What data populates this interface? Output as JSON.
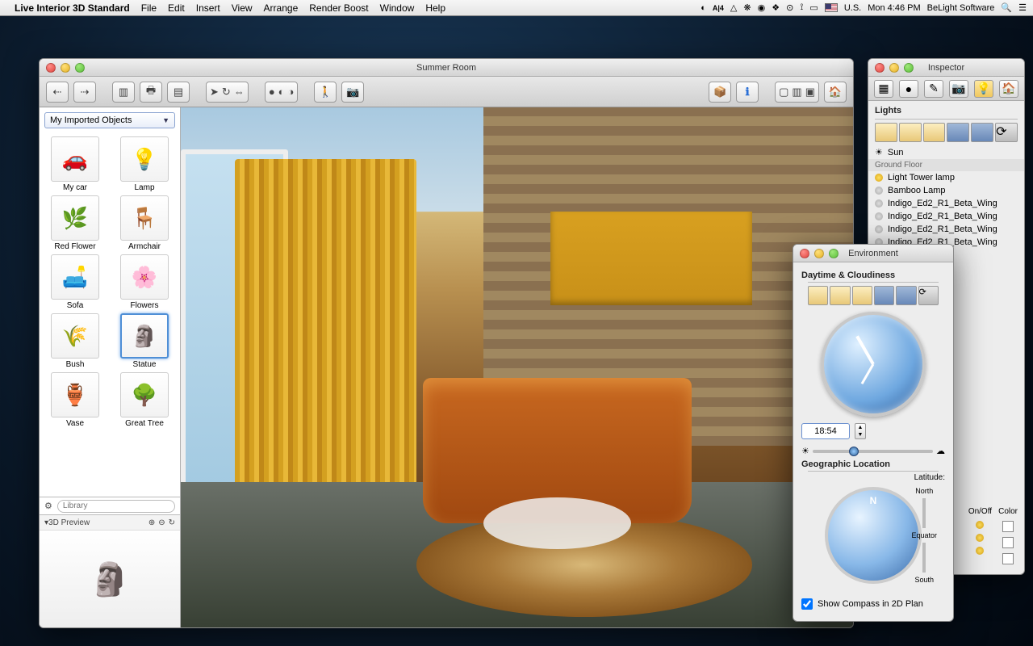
{
  "menubar": {
    "apple": "",
    "app_name": "Live Interior 3D Standard",
    "items": [
      "File",
      "Edit",
      "Insert",
      "View",
      "Arrange",
      "Render Boost",
      "Window",
      "Help"
    ],
    "status_icons": [
      "sync-icon",
      "adobe-icon",
      "drive-icon",
      "cloud-icon",
      "dropbox-icon",
      "bt-icon",
      "vol-icon",
      "wifi-icon",
      "battery-icon"
    ],
    "locale": "U.S.",
    "clock": "Mon 4:46 PM",
    "user": "BeLight Software"
  },
  "main": {
    "title": "Summer Room",
    "toolbar": {
      "nav": [
        "back",
        "fwd"
      ],
      "left": [
        "library-toggle",
        "print",
        "layers"
      ],
      "select": [
        "pointer",
        "orbit",
        "pan"
      ],
      "record": [
        "record",
        "play",
        "stop"
      ],
      "walk": "walk",
      "camera": "camera",
      "right": [
        "export-3d",
        "info",
        "2d-view",
        "split-view",
        "3d-view",
        "home"
      ]
    },
    "library": {
      "dropdown": "My Imported Objects",
      "items": [
        {
          "label": "My car",
          "glyph": "🚗"
        },
        {
          "label": "Lamp",
          "glyph": "💡"
        },
        {
          "label": "Red Flower",
          "glyph": "🌿"
        },
        {
          "label": "Armchair",
          "glyph": "🪑"
        },
        {
          "label": "Sofa",
          "glyph": "🛋️"
        },
        {
          "label": "Flowers",
          "glyph": "🌸"
        },
        {
          "label": "Bush",
          "glyph": "🌾"
        },
        {
          "label": "Statue",
          "glyph": "🗿",
          "selected": true
        },
        {
          "label": "Vase",
          "glyph": "🏺"
        },
        {
          "label": "Great Tree",
          "glyph": "🌳"
        }
      ],
      "search_placeholder": "Library",
      "preview_header": "3D Preview",
      "preview_zoom": [
        "zoom-in",
        "zoom-out",
        "rotate"
      ]
    }
  },
  "inspector": {
    "title": "Inspector",
    "tabs": [
      "furniture",
      "materials",
      "edit",
      "camera",
      "lights",
      "house"
    ],
    "section": "Lights",
    "sun_label": "Sun",
    "floor_label": "Ground Floor",
    "lights": [
      {
        "name": "Light Tower lamp",
        "on": true
      },
      {
        "name": "Bamboo Lamp",
        "on": false
      },
      {
        "name": "Indigo_Ed2_R1_Beta_Wing",
        "on": false
      },
      {
        "name": "Indigo_Ed2_R1_Beta_Wing",
        "on": false
      },
      {
        "name": "Indigo_Ed2_R1_Beta_Wing",
        "on": false
      },
      {
        "name": "Indigo_Ed2_R1_Beta_Wing",
        "on": false
      }
    ],
    "col_headers": [
      "On/Off",
      "Color"
    ]
  },
  "environment": {
    "title": "Environment",
    "section1": "Daytime & Cloudiness",
    "time_value": "18:54",
    "section2": "Geographic Location",
    "latitude_label": "Latitude:",
    "lat_ticks": [
      "North",
      "Equator",
      "South"
    ],
    "show_compass": "Show Compass in 2D Plan",
    "show_compass_checked": true
  }
}
